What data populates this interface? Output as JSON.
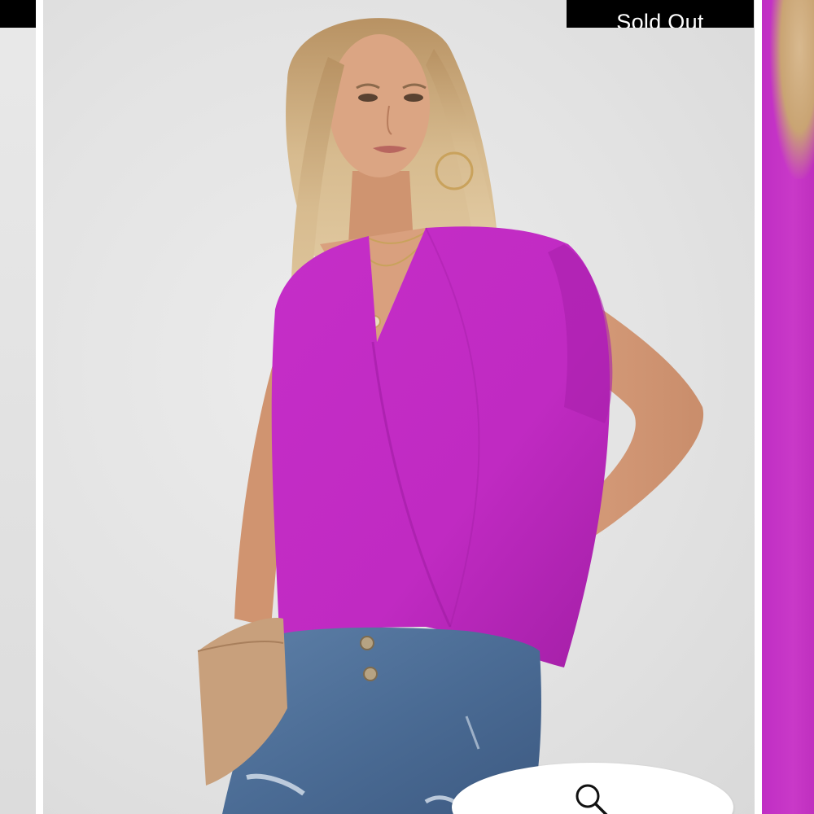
{
  "gallery": {
    "badge_text": "Sold Out",
    "zoom_icon": "search-icon",
    "product_color": "#c42bc6",
    "badge_color": "#000000",
    "background_color": "#e6e6e6"
  }
}
